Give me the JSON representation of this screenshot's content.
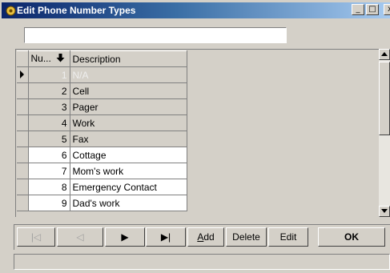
{
  "window": {
    "title": "Edit Phone Number Types",
    "minimize": "_",
    "maximize": "□",
    "close": "x"
  },
  "search": {
    "value": "",
    "placeholder": ""
  },
  "grid": {
    "columns": [
      "Nu...",
      "Description"
    ],
    "sort_icon": "arrow-down-icon",
    "rows": [
      {
        "number": "1",
        "description": "N/A"
      },
      {
        "number": "2",
        "description": "Cell"
      },
      {
        "number": "3",
        "description": "Pager"
      },
      {
        "number": "4",
        "description": "Work"
      },
      {
        "number": "5",
        "description": "Fax"
      },
      {
        "number": "6",
        "description": "Cottage"
      },
      {
        "number": "7",
        "description": "Mom's work"
      },
      {
        "number": "8",
        "description": "Emergency Contact"
      },
      {
        "number": "9",
        "description": "Dad's work"
      }
    ]
  },
  "toolbar": {
    "first": "|◁",
    "prev": "◁",
    "next": "▶",
    "last": "▶|",
    "add_prefix": "A",
    "add_rest": "dd",
    "delete": "Delete",
    "edit": "Edit",
    "ok": "OK"
  },
  "status": {
    "text": ""
  }
}
